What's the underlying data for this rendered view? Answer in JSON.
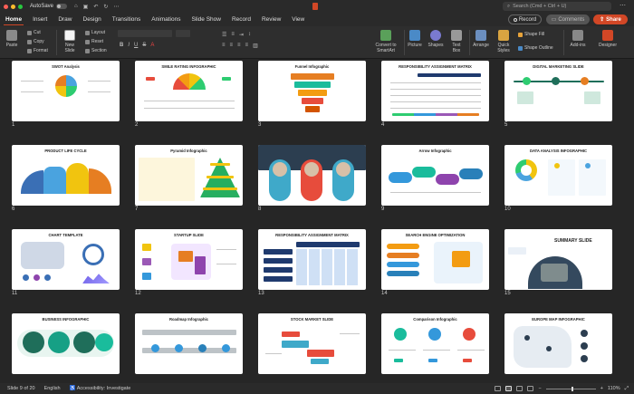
{
  "titlebar": {
    "autosave_label": "AutoSave",
    "search_placeholder": "Search (Cmd + Ctrl + U)"
  },
  "menu": {
    "tabs": [
      "Home",
      "Insert",
      "Draw",
      "Design",
      "Transitions",
      "Animations",
      "Slide Show",
      "Record",
      "Review",
      "View"
    ],
    "active": "Home",
    "record_label": "Record",
    "comments_label": "Comments",
    "share_label": "Share"
  },
  "ribbon": {
    "paste": "Paste",
    "cut": "Cut",
    "copy": "Copy",
    "format": "Format",
    "new_slide": "New Slide",
    "layout": "Layout",
    "reset": "Reset",
    "section": "Section",
    "convert": "Convert to SmartArt",
    "picture": "Picture",
    "shapes": "Shapes",
    "textbox": "Text Box",
    "arrange": "Arrange",
    "quick_styles": "Quick Styles",
    "shape_fill": "Shape Fill",
    "shape_outline": "Shape Outline",
    "addins": "Add-ins",
    "designer": "Designer"
  },
  "slides": [
    {
      "num": "1",
      "title": "SWOT Analysis"
    },
    {
      "num": "2",
      "title": "SMILE RATING INFOGRAPHIC"
    },
    {
      "num": "3",
      "title": "Funnel Infographic"
    },
    {
      "num": "4",
      "title": "RESPONSIBILITY ASSIGNMENT MATRIX"
    },
    {
      "num": "5",
      "title": "DIGITAL MARKETING SLIDE"
    },
    {
      "num": "6",
      "title": "PRODUCT LIFE CYCLE"
    },
    {
      "num": "7",
      "title": "Pyramid Infographic"
    },
    {
      "num": "8",
      "title": "TEAM SLIDE"
    },
    {
      "num": "9",
      "title": "Arrow Infographic"
    },
    {
      "num": "10",
      "title": "DATA ANALYSIS INFOGRAPHIC"
    },
    {
      "num": "11",
      "title": "CHART TEMPLATE"
    },
    {
      "num": "12",
      "title": "STARTUP SLIDE"
    },
    {
      "num": "13",
      "title": "RESPONSIBILITY ASSIGNMENT MATRIX"
    },
    {
      "num": "14",
      "title": "SEARCH ENGINE OPTIMIZATION"
    },
    {
      "num": "15",
      "title": "SUMMARY SLIDE"
    },
    {
      "num": "16",
      "title": "BUSINESS INFOGRAPHIC"
    },
    {
      "num": "17",
      "title": "Roadmap Infographic"
    },
    {
      "num": "18",
      "title": "STOCK MARKET SLIDE"
    },
    {
      "num": "19",
      "title": "Comparison Infographic"
    },
    {
      "num": "20",
      "title": "EUROPE MAP INFOGRAPHIC"
    }
  ],
  "status": {
    "slide_of": "Slide 9 of 20",
    "language": "English",
    "accessibility": "Accessibility: Investigate",
    "zoom": "110%"
  },
  "colors": {
    "accent": "#d24726"
  }
}
